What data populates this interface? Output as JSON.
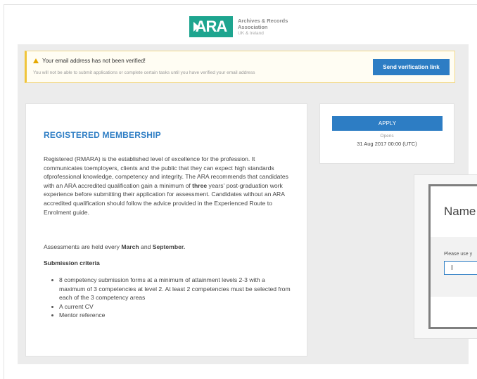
{
  "logo": {
    "mark": "ARA",
    "line1": "Archives & Records",
    "line2": "Association",
    "sub": "UK & Ireland"
  },
  "alert": {
    "title": "Your email address has not been verified!",
    "body": "You will not be able to submit applications or complete certain tasks until you have verified your email address",
    "button": "Send verification link"
  },
  "membership": {
    "title": "REGISTERED MEMBERSHIP",
    "para_a": "Registered (RMARA) is the established level of excellence for the profession. It communicates toemployers, clients and the public that they can expect high standards ofprofessional knowledge, competency and integrity. The ARA recommends that candidates with an ARA accredited qualification gain a minimum of ",
    "para_bold": "three",
    "para_b": " years' post-graduation work experience before submitting their application for assessment. Candidates without an ARA accredited qualification should follow the advice provided in the Experienced Route to Enrolment guide.",
    "assess_a": "Assessments are held every ",
    "assess_m1": "March",
    "assess_and": " and ",
    "assess_m2": "September.",
    "criteria_heading": "Submission criteria",
    "criteria": [
      "8 competency submission forms at a minimum of attainment levels 2-3 with a maximum of 3 competencies at level 2. At least 2 competencies must be selected from each of the 3 competency areas",
      "A current CV",
      "Mentor reference"
    ]
  },
  "apply": {
    "button": "APPLY",
    "opens_label": "Opens",
    "opens_date": "31 Aug 2017 00:00 (UTC)"
  },
  "modal": {
    "title": "Name",
    "hint": "Please use y",
    "input_value": "I"
  }
}
